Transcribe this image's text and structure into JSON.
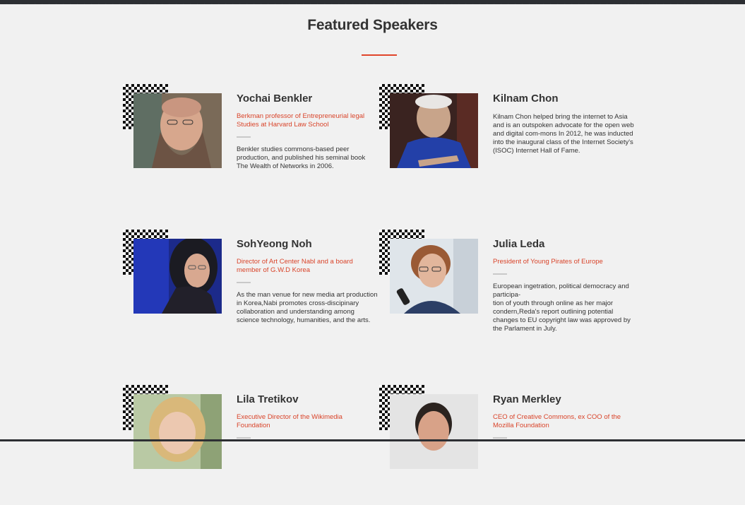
{
  "section": {
    "title": "Featured Speakers"
  },
  "speakers": [
    {
      "name": "Yochai Benkler",
      "role": "Berkman professor of Entrepreneurial legal Studies at Harvard Law School",
      "bio": "Benkler studies commons-based peer production, and published his seminal book The Wealth of Networks in 2006."
    },
    {
      "name": "Kilnam Chon",
      "role": "",
      "bio": "Kilnam Chon helped bring the internet to Asia and is an outspoken advocate for the open web and digital com-mons In 2012, he was inducted into the inaugural class of the Internet Society's (ISOC) Internet Hall of Fame."
    },
    {
      "name": "SohYeong Noh",
      "role": "Director of Art Center Nabl and a board member of G.W.D Korea",
      "bio": "As the man venue for new media art production in Korea,Nabi promotes cross-discipinary collaboration and understanding among science technology, humanities, and the arts."
    },
    {
      "name": "Julia Leda",
      "role": "President of Young Pirates of Europe",
      "bio": "European ingetration, political democracy and participa-\ntion of youth through online as her major condern,Reda's report outlining potential changes to EU copyright law was approved by the Parlament in July."
    },
    {
      "name": "Lila Tretikov",
      "role": "Executive Director of the Wikimedia Foundation",
      "bio": ""
    },
    {
      "name": "Ryan Merkley",
      "role": "CEO of Creative Commons, ex COO of the Mozilla Foundation",
      "bio": ""
    }
  ],
  "colors": {
    "accent": "#e0452b",
    "background": "#f1f1f1",
    "text": "#333333"
  }
}
